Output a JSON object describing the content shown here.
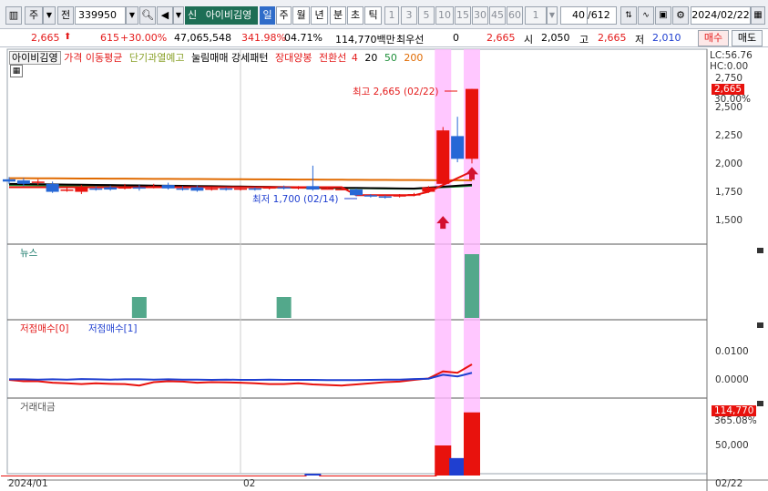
{
  "toolbar": {
    "mode": "주",
    "type": "전",
    "code": "339950",
    "credit": "신",
    "name": "아이비김영",
    "periods": [
      "일",
      "주",
      "월",
      "년",
      "분",
      "초",
      "틱"
    ],
    "minutes": [
      "1",
      "3",
      "5",
      "10",
      "15",
      "30",
      "45",
      "60"
    ],
    "minute_value": "1",
    "count": "40",
    "count_total": "/612",
    "date": "2024/02/22"
  },
  "quote": {
    "price": "2,665",
    "change": "615",
    "change_pct": "+30.00%",
    "volume": "47,065,548",
    "volume_ratio": "341.98%",
    "turnover": "04.71%",
    "amount": "114,770백만",
    "priority_label": "최우선",
    "priority_value": "0",
    "priority_price": "2,665",
    "open_label": "시",
    "open": "2,050",
    "high_label": "고",
    "high": "2,665",
    "low_label": "저",
    "low": "2,010",
    "buy": "매수",
    "sell": "매도"
  },
  "legend": {
    "name": "아이비김영",
    "ma": "가격 이동평균",
    "short": "단기과열예고",
    "pattern": "눌림매매 강세패턴",
    "bull": "장대양봉",
    "turn": "전환선",
    "p4": "4",
    "p20": "20",
    "p50": "50",
    "p200": "200"
  },
  "chart_data": {
    "type": "candlestick",
    "categories": [
      "2024/01",
      "02",
      "02/22"
    ],
    "price_axis": [
      "2,750",
      "2,500",
      "2,250",
      "2,000",
      "1,750",
      "1,500"
    ],
    "lc": "LC:56.76",
    "hc": "HC:0.00",
    "last_price": "2,665",
    "last_pct": "30.00%",
    "high_annotation": "최고 2,665 (02/22)",
    "low_annotation": "최저 1,700 (02/14)",
    "news_label": "뉴스",
    "signal_labels": [
      "저점매수[0]",
      "저점매수[1]"
    ],
    "signal_axis": [
      "0.0100",
      "0.0000"
    ],
    "amount_label": "거래대금",
    "amount_axis": [
      "50,000"
    ],
    "amount_last": "114,770",
    "amount_last_pct": "365.08%",
    "candles": [
      {
        "o": 1870,
        "c": 1850,
        "h": 1890,
        "l": 1830
      },
      {
        "o": 1860,
        "c": 1830,
        "h": 1880,
        "l": 1810
      },
      {
        "o": 1845,
        "c": 1850,
        "h": 1870,
        "l": 1820
      },
      {
        "o": 1830,
        "c": 1760,
        "h": 1850,
        "l": 1750
      },
      {
        "o": 1770,
        "c": 1780,
        "h": 1800,
        "l": 1760
      },
      {
        "o": 1760,
        "c": 1800,
        "h": 1820,
        "l": 1740
      },
      {
        "o": 1790,
        "c": 1780,
        "h": 1810,
        "l": 1770
      },
      {
        "o": 1800,
        "c": 1780,
        "h": 1815,
        "l": 1770
      },
      {
        "o": 1790,
        "c": 1800,
        "h": 1830,
        "l": 1780
      },
      {
        "o": 1800,
        "c": 1790,
        "h": 1820,
        "l": 1770
      },
      {
        "o": 1800,
        "c": 1810,
        "h": 1830,
        "l": 1790
      },
      {
        "o": 1820,
        "c": 1790,
        "h": 1840,
        "l": 1780
      },
      {
        "o": 1790,
        "c": 1780,
        "h": 1810,
        "l": 1770
      },
      {
        "o": 1800,
        "c": 1770,
        "h": 1815,
        "l": 1760
      },
      {
        "o": 1780,
        "c": 1790,
        "h": 1800,
        "l": 1770
      },
      {
        "o": 1790,
        "c": 1780,
        "h": 1800,
        "l": 1770
      },
      {
        "o": 1780,
        "c": 1790,
        "h": 1800,
        "l": 1770
      },
      {
        "o": 1790,
        "c": 1780,
        "h": 1800,
        "l": 1770
      },
      {
        "o": 1790,
        "c": 1800,
        "h": 1810,
        "l": 1780
      },
      {
        "o": 1800,
        "c": 1790,
        "h": 1815,
        "l": 1780
      },
      {
        "o": 1790,
        "c": 1800,
        "h": 1810,
        "l": 1780
      },
      {
        "o": 1810,
        "c": 1780,
        "h": 1990,
        "l": 1770
      },
      {
        "o": 1790,
        "c": 1790,
        "h": 1800,
        "l": 1780
      },
      {
        "o": 1785,
        "c": 1785,
        "h": 1795,
        "l": 1775
      },
      {
        "o": 1780,
        "c": 1730,
        "h": 1790,
        "l": 1720
      },
      {
        "o": 1730,
        "c": 1720,
        "h": 1740,
        "l": 1710
      },
      {
        "o": 1720,
        "c": 1710,
        "h": 1730,
        "l": 1700
      },
      {
        "o": 1720,
        "c": 1730,
        "h": 1740,
        "l": 1710
      },
      {
        "o": 1730,
        "c": 1740,
        "h": 1750,
        "l": 1720
      },
      {
        "o": 1760,
        "c": 1800,
        "h": 1810,
        "l": 1750
      },
      {
        "o": 1830,
        "c": 2300,
        "h": 2330,
        "l": 1820
      },
      {
        "o": 2250,
        "c": 2050,
        "h": 2420,
        "l": 2020
      },
      {
        "o": 2050,
        "c": 2665,
        "h": 2665,
        "l": 2010
      }
    ],
    "news": [
      0,
      0,
      0,
      0,
      0,
      0,
      0,
      0,
      0,
      1,
      0,
      0,
      0,
      0,
      0,
      0,
      0,
      0,
      0,
      1,
      0,
      0,
      0,
      0,
      0,
      0,
      0,
      0,
      0,
      0,
      0,
      0,
      3
    ],
    "signal0": [
      0,
      -0.0005,
      -0.0005,
      -0.001,
      -0.0012,
      -0.0015,
      -0.0012,
      -0.0014,
      -0.0015,
      -0.002,
      -0.0008,
      -0.0005,
      -0.0006,
      -0.001,
      -0.0008,
      -0.0009,
      -0.001,
      -0.0012,
      -0.0015,
      -0.0015,
      -0.0012,
      -0.0016,
      -0.0018,
      -0.002,
      -0.0016,
      -0.0012,
      -0.0008,
      -0.0006,
      0,
      0.0005,
      0.003,
      0.0025,
      0.0055
    ],
    "signal1": [
      0.0002,
      0.0002,
      0.0001,
      0.0002,
      0.0001,
      0.0003,
      0.0002,
      0.0001,
      0.0002,
      0.0002,
      0.0001,
      0.0002,
      0.0001,
      0.0001,
      0,
      0.0001,
      0,
      0,
      0.0001,
      0,
      0,
      0,
      -0.0001,
      -0.0001,
      -0.0001,
      0,
      0.0001,
      0.0001,
      0.0003,
      0.0004,
      0.0018,
      0.0012,
      0.0025
    ],
    "amount": [
      1,
      1,
      1,
      1,
      1,
      1,
      1,
      1,
      1,
      1,
      1,
      1,
      1,
      1,
      1,
      1,
      1,
      1,
      1,
      1,
      1,
      1,
      1,
      1,
      1,
      1,
      1,
      1,
      1,
      1,
      50000,
      29000,
      105000
    ]
  },
  "colors": {
    "up": "#e8120d",
    "down": "#2667d6",
    "highlight": "#ffb9ff",
    "news": "#53a88b"
  }
}
